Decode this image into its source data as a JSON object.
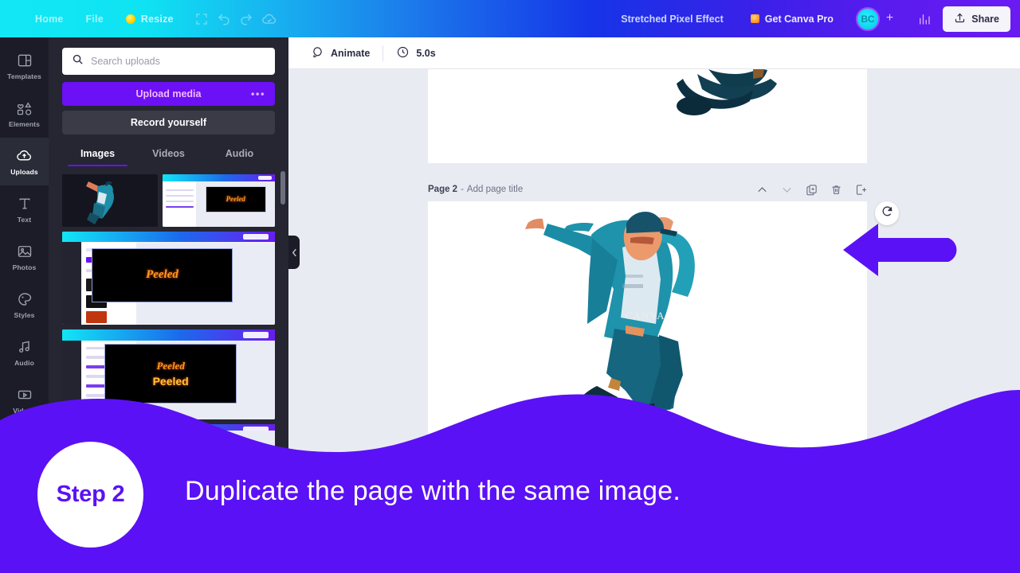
{
  "header": {
    "menu": [
      {
        "label": "Home",
        "icon": "home-icon"
      },
      {
        "label": "File",
        "icon": "file-icon"
      }
    ],
    "resize_label": "Resize",
    "icons": [
      "magic-resize-icon",
      "undo-icon",
      "redo-icon",
      "cloud-saved-icon"
    ],
    "doc_title": "Stretched Pixel Effect",
    "pro_label": "Get Canva Pro",
    "avatar_initials": "BC",
    "plus_label": "+",
    "insights_icon": "bar-chart-icon",
    "share_label": "Share",
    "share_icon": "share-upload-icon"
  },
  "sidebar": {
    "items": [
      {
        "label": "Templates",
        "icon": "templates-icon",
        "active": false
      },
      {
        "label": "Elements",
        "icon": "elements-icon",
        "active": false
      },
      {
        "label": "Uploads",
        "icon": "uploads-cloud-icon",
        "active": true
      },
      {
        "label": "Text",
        "icon": "text-icon",
        "active": false
      },
      {
        "label": "Photos",
        "icon": "photos-icon",
        "active": false
      },
      {
        "label": "Styles",
        "icon": "styles-palette-icon",
        "active": false
      },
      {
        "label": "Audio",
        "icon": "audio-note-icon",
        "active": false
      },
      {
        "label": "Videos",
        "icon": "videos-icon",
        "active": false
      }
    ]
  },
  "uploads_panel": {
    "search_placeholder": "Search uploads",
    "search_value": "",
    "search_icon": "search-icon",
    "upload_button": "Upload media",
    "upload_more_icon": "ellipsis-icon",
    "record_button": "Record yourself",
    "tabs": [
      {
        "label": "Images",
        "active": true
      },
      {
        "label": "Videos",
        "active": false
      },
      {
        "label": "Audio",
        "active": false
      }
    ],
    "thumbnails": [
      {
        "name": "dancer-cutout-thumbnail",
        "caption": ""
      },
      {
        "name": "canva-screenshot-peeled-thumbnail",
        "caption": "Peeled"
      },
      {
        "name": "canva-editor-screenshot-thumbnail",
        "caption": "Peeled"
      },
      {
        "name": "canva-editor-peeled-text-thumbnail",
        "caption": "Peeled"
      },
      {
        "name": "canva-editor-partial-thumbnail",
        "caption": ""
      }
    ]
  },
  "canvas_toolbar": {
    "animate_label": "Animate",
    "animate_icon": "animate-icon",
    "duration_label": "5.0s",
    "duration_icon": "clock-icon"
  },
  "page": {
    "label": "Page 2",
    "separator": "-",
    "title_placeholder": "Add page title",
    "tools": [
      {
        "name": "move-page-up-icon",
        "label": "Move up"
      },
      {
        "name": "move-page-down-icon",
        "label": "Move down"
      },
      {
        "name": "duplicate-page-icon",
        "label": "Duplicate page"
      },
      {
        "name": "delete-page-icon",
        "label": "Delete page"
      },
      {
        "name": "add-page-icon",
        "label": "Add page"
      }
    ],
    "watermark": "CANVA",
    "floating_duplicate_icon": "duplicate-rotate-icon"
  },
  "annotation": {
    "arrow_name": "purple-pointer-arrow",
    "arrow_color": "#5B11F5"
  },
  "overlay": {
    "step_badge": "Step 2",
    "caption": "Duplicate the page with the same image.",
    "wave_color": "#5B11F5",
    "text_color": "#FFFFFF"
  }
}
